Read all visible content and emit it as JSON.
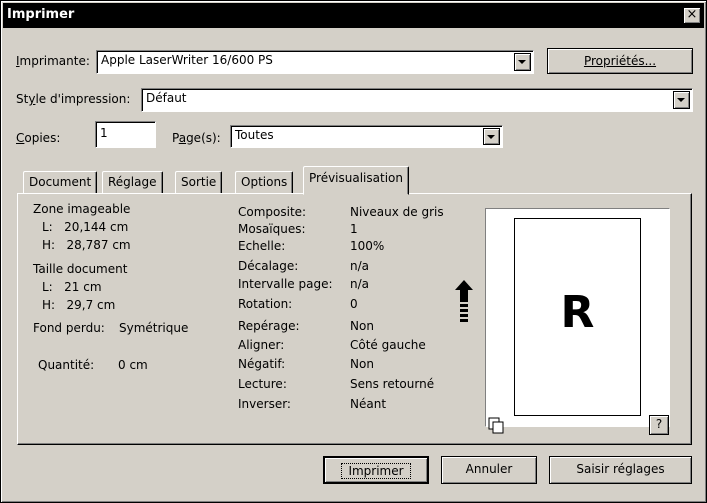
{
  "window": {
    "title": "Imprimer",
    "close_glyph": "×"
  },
  "printer": {
    "label_first": "I",
    "label_rest": "mprimante:",
    "value": "Apple LaserWriter 16/600 PS",
    "properties_button": "Propriétés..."
  },
  "style": {
    "label_a": "St",
    "label_u": "y",
    "label_b": "le d'impression:",
    "value": "Défaut"
  },
  "copies": {
    "label_u": "C",
    "label_rest": "opies:",
    "value": "1"
  },
  "pages": {
    "label_a": "P",
    "label_u": "a",
    "label_b": "ge(s):",
    "value": "Toutes"
  },
  "tabs": [
    "Document",
    "Réglage",
    "Sortie",
    "Options",
    "Prévisualisation"
  ],
  "active_tab": "Prévisualisation",
  "preview": {
    "zone_title": "Zone imageable",
    "zone_l": "L:   20,144 cm",
    "zone_h": "H:   28,787 cm",
    "size_title": "Taille document",
    "size_l": "L:   21 cm",
    "size_h": "H:   29,7 cm",
    "bleed_label": "Fond perdu:",
    "bleed_value": "Symétrique",
    "quantity_label": "Quantité:",
    "quantity_value": "0 cm",
    "settings": [
      {
        "label": "Composite:",
        "value": "Niveaux de gris"
      },
      {
        "label": "Mosaïques:",
        "value": "1"
      },
      {
        "label": "Echelle:",
        "value": "100%"
      },
      {
        "label": "Décalage:",
        "value": "n/a"
      },
      {
        "label": "Intervalle page:",
        "value": "n/a"
      },
      {
        "label": "Rotation:",
        "value": "0"
      },
      {
        "label": "Repérage:",
        "value": "Non"
      },
      {
        "label": "Aligner:",
        "value": "Côté gauche"
      },
      {
        "label": "Négatif:",
        "value": "Non"
      },
      {
        "label": "Lecture:",
        "value": "Sens retourné"
      },
      {
        "label": "Inverser:",
        "value": "Néant"
      }
    ],
    "page_letter": "R",
    "help_button": "?"
  },
  "buttons": {
    "print": "Imprimer",
    "cancel": "Annuler",
    "capture": "Saisir réglages"
  }
}
